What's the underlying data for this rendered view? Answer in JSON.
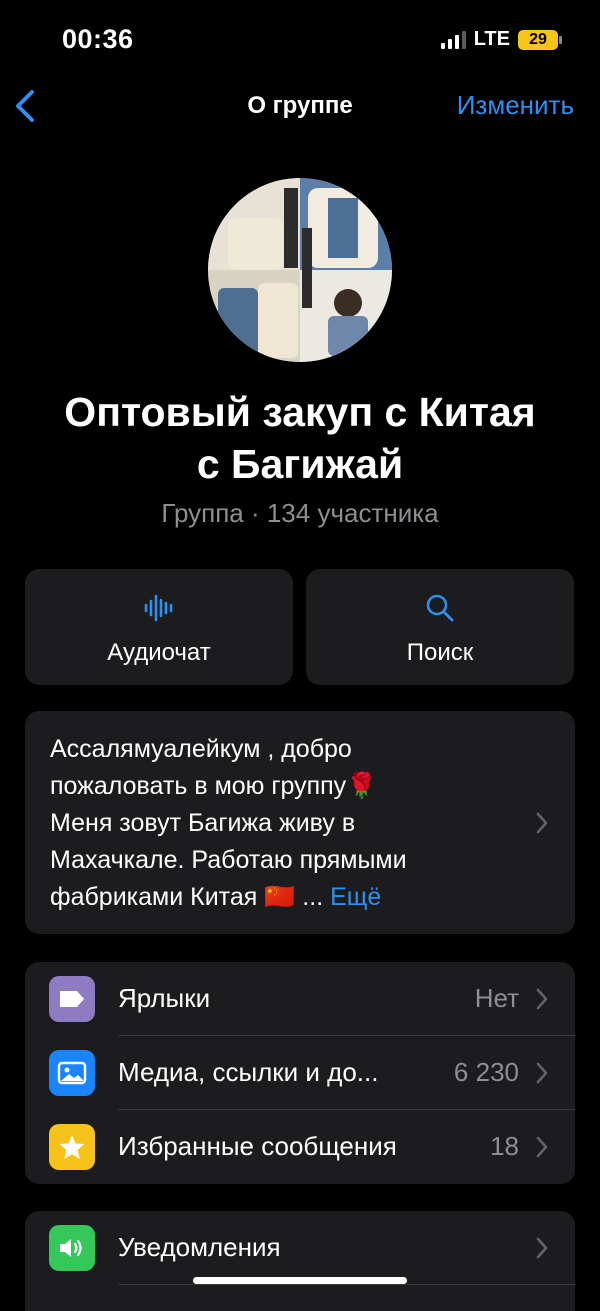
{
  "status_bar": {
    "time": "00:36",
    "network": "LTE",
    "battery": "29"
  },
  "nav": {
    "back_label": "",
    "title": "О группе",
    "edit_label": "Изменить"
  },
  "group": {
    "title_line1": "Оптовый закуп с Китая",
    "title_line2": "с Багижай",
    "subtitle": "Группа · 134 участника"
  },
  "actions": [
    {
      "label": "Аудиочат",
      "icon": "waveform-icon"
    },
    {
      "label": "Поиск",
      "icon": "search-icon"
    }
  ],
  "description": {
    "text_line1": "Ассалямуалейкум ,  добро",
    "text_line2": "пожаловать в мою группу🌹",
    "text_line3": "Меня зовут Багижа живу в",
    "text_line4": "Махачкале. Работаю прямыми",
    "text_line5": "фабриками Китая 🇨🇳 ...",
    "more_label": "Ещё"
  },
  "list1": [
    {
      "label": "Ярлыки",
      "value": "Нет",
      "icon": "tag-icon",
      "color": "#8e7cc3"
    },
    {
      "label": "Медиа, ссылки и до...",
      "value": "6 230",
      "icon": "photo-icon",
      "color": "#1a84ff"
    },
    {
      "label": "Избранные сообщения",
      "value": "18",
      "icon": "star-icon",
      "color": "#f7c31b"
    }
  ],
  "list2": [
    {
      "label": "Уведомления",
      "value": "",
      "icon": "speaker-icon",
      "color": "#34c759"
    }
  ],
  "colors": {
    "accent": "#2f8ff0",
    "card": "#1c1c1e",
    "secondary_text": "#8e8e93"
  }
}
